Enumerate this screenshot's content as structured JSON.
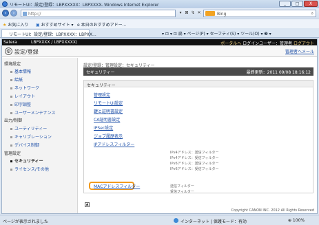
{
  "window": {
    "title": "リモートUI：設定/登録：LBPXXXXX：LBPXXXX- Windows Internet Explorer",
    "buttons": [
      "_",
      "□",
      "X"
    ]
  },
  "address_bar": {
    "url": "http://",
    "search_engine": "Bing",
    "search_icon": "search-icon",
    "go_labels": [
      "▾",
      "⊠",
      "↯",
      "✕"
    ]
  },
  "favorites_bar": {
    "favorites": "お気に入り",
    "suggested": "おすすめサイト ▾",
    "gallery": "e 本日のおすすめアドー..."
  },
  "tab_row": {
    "tab_title": "リモートUI：設定/登録：LBPXXXX：LBPXX...",
    "commands": "▾ ⊡ ▾ ⊡ 扁 ▾ ページ(P) ▾ セーフティ(S) ▾ ツール(O) ▾ ❷ ▾"
  },
  "header": {
    "brand": "Satera",
    "device": "LBPXXXX / LBPXXXXX/",
    "portal_link": "ポータルへ",
    "login_user": "ログインユーザー：管理者",
    "logout": "ログアウト",
    "page_title": "設定/登録",
    "admin_mail": "管理者へメール"
  },
  "left_nav": {
    "sections": [
      {
        "heading": "環境設定",
        "items": [
          "基本情報",
          "給紙",
          "ネットワーク",
          "レイアウト",
          "印字調整",
          "ユーザーメンテナンス"
        ]
      },
      {
        "heading": "出力/制御",
        "items": [
          "ユーティリティー",
          "キャリブレーション",
          "デバイス制御"
        ]
      },
      {
        "heading": "管理設定",
        "items": [
          "セキュリティー",
          "ライセンス/その他"
        ]
      }
    ],
    "selected": "セキュリティー"
  },
  "main": {
    "breadcrumb": "設定/登録：管理設定：セキュリティー",
    "section_title": "セキュリティー",
    "last_updated": "最終更新：2011 09/08 18:16:12",
    "box_header": "セキュリティー",
    "links": [
      "管理設定",
      "リモートUI設定",
      "鍵と証明書設定",
      "CA証明書設定",
      "IPSec設定",
      "ジョブ履歴表示",
      "IPアドレスフィルター"
    ],
    "ip_filter_descriptions": [
      "IPv4アドレス：送信フィルター",
      "IPv4アドレス：受信フィルター",
      "IPv6アドレス：送信フィルター",
      "IPv6アドレス：受信フィルター"
    ],
    "mac_filter_link": "MACアドレスフィルター",
    "mac_filter_descriptions": [
      "送信フィルター",
      "受信フィルター"
    ],
    "top_button": "▲",
    "copyright": "Copyright CANON INC. 2012 All Rights Reserved"
  },
  "status_bar": {
    "left": "ページが表示されました",
    "zone": "インターネット | 保護モード：有効",
    "zoom": "⊕ 100%"
  }
}
